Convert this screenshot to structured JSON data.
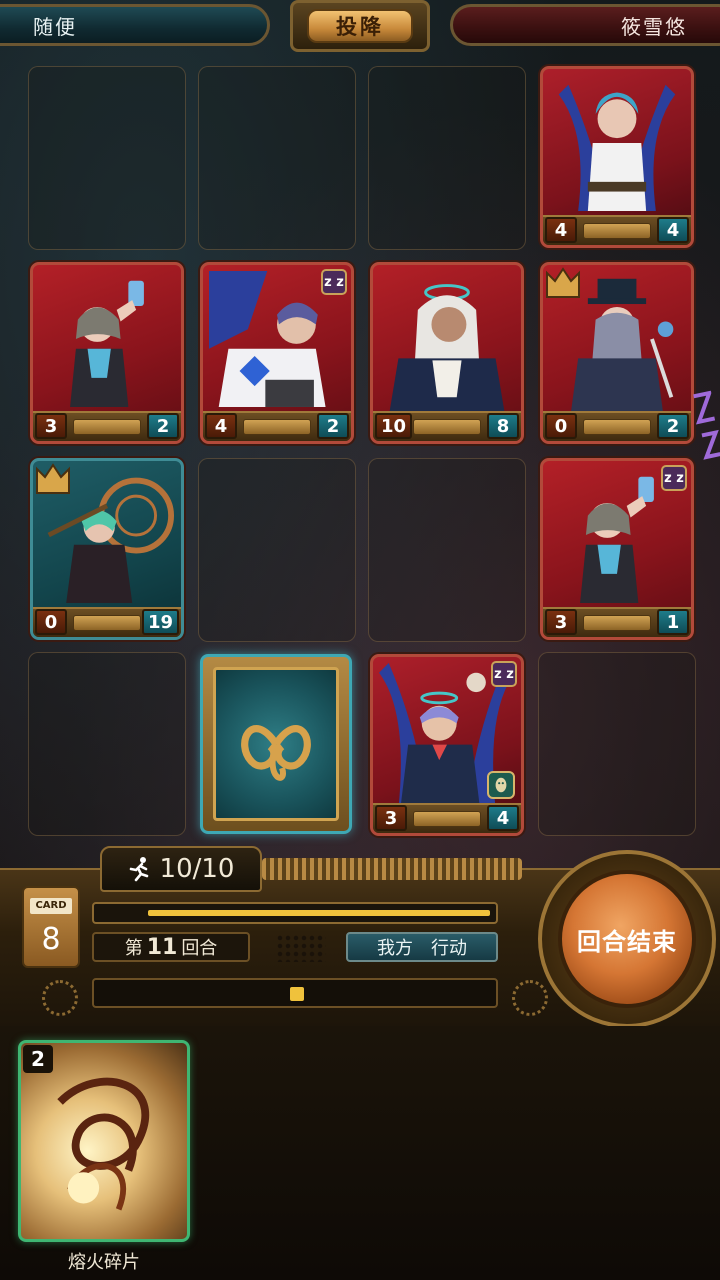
{
  "top_bar": {
    "player_name": "随便",
    "surrender_label": "投降",
    "opponent_name": "筱雪悠"
  },
  "board": {
    "cards": [
      {
        "id": "r1c4",
        "color": "blue",
        "attack": "4",
        "health": "4",
        "sleeping": false,
        "crown": false,
        "mask": false
      },
      {
        "id": "r2c1",
        "color": "red",
        "attack": "3",
        "health": "2",
        "sleeping": false,
        "crown": false,
        "mask": false
      },
      {
        "id": "r2c2",
        "color": "red",
        "attack": "4",
        "health": "2",
        "sleeping": true,
        "crown": false,
        "mask": false
      },
      {
        "id": "r2c3",
        "color": "red",
        "attack": "10",
        "health": "8",
        "sleeping": false,
        "crown": false,
        "mask": false
      },
      {
        "id": "r2c4",
        "color": "red",
        "attack": "0",
        "health": "2",
        "sleeping": false,
        "crown": true,
        "mask": false
      },
      {
        "id": "r3c1",
        "color": "teal",
        "attack": "0",
        "health": "19",
        "sleeping": false,
        "crown": true,
        "mask": false
      },
      {
        "id": "r3c4",
        "color": "red",
        "attack": "3",
        "health": "1",
        "sleeping": true,
        "crown": false,
        "mask": false
      },
      {
        "id": "r4c3",
        "color": "blue",
        "attack": "3",
        "health": "4",
        "sleeping": true,
        "crown": false,
        "mask": true
      }
    ],
    "sleep_icon_text": "z z"
  },
  "panel": {
    "action_points": "10/10",
    "card_label": "CARD",
    "card_count": "8",
    "turn_prefix": "第",
    "turn_number": "11",
    "turn_suffix": "回合",
    "phase_side": "我方",
    "phase_action": "行动",
    "end_turn_label": "回合结束",
    "progress_fraction": 0.92
  },
  "hand": [
    {
      "cost": "2",
      "name": "熔火碎片"
    }
  ],
  "colors": {
    "accent_gold": "#c8893a",
    "end_turn_orange": "#d57634",
    "player_teal": "#1f4a54",
    "opponent_red": "#5a1d1d",
    "hand_highlight": "#3fb672"
  }
}
